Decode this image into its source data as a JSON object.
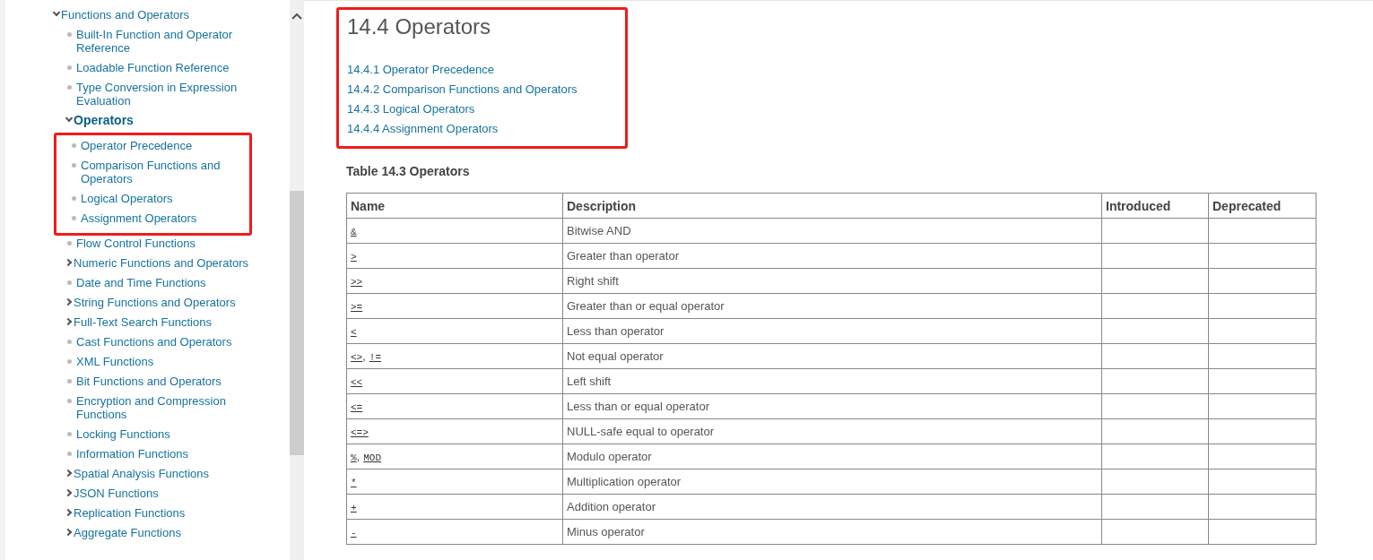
{
  "sidebar": {
    "items": [
      {
        "label": "Functions and Operators",
        "kind": "branch",
        "expanded": true,
        "selected": false,
        "children": [
          {
            "label": "Built-In Function and Operator Reference",
            "kind": "leaf",
            "selected": false
          },
          {
            "label": "Loadable Function Reference",
            "kind": "leaf",
            "selected": false
          },
          {
            "label": "Type Conversion in Expression Evaluation",
            "kind": "leaf",
            "selected": false
          },
          {
            "label": "Operators",
            "kind": "branch",
            "expanded": true,
            "selected": true,
            "highlighted": true,
            "children": [
              {
                "label": "Operator Precedence",
                "kind": "leaf",
                "selected": false
              },
              {
                "label": "Comparison Functions and Operators",
                "kind": "leaf",
                "selected": false
              },
              {
                "label": "Logical Operators",
                "kind": "leaf",
                "selected": false
              },
              {
                "label": "Assignment Operators",
                "kind": "leaf",
                "selected": false
              }
            ]
          },
          {
            "label": "Flow Control Functions",
            "kind": "leaf",
            "selected": false
          },
          {
            "label": "Numeric Functions and Operators",
            "kind": "branch",
            "expanded": false,
            "selected": false
          },
          {
            "label": "Date and Time Functions",
            "kind": "leaf",
            "selected": false
          },
          {
            "label": "String Functions and Operators",
            "kind": "branch",
            "expanded": false,
            "selected": false
          },
          {
            "label": "Full-Text Search Functions",
            "kind": "branch",
            "expanded": false,
            "selected": false
          },
          {
            "label": "Cast Functions and Operators",
            "kind": "leaf",
            "selected": false
          },
          {
            "label": "XML Functions",
            "kind": "leaf",
            "selected": false
          },
          {
            "label": "Bit Functions and Operators",
            "kind": "leaf",
            "selected": false
          },
          {
            "label": "Encryption and Compression Functions",
            "kind": "leaf",
            "selected": false
          },
          {
            "label": "Locking Functions",
            "kind": "leaf",
            "selected": false
          },
          {
            "label": "Information Functions",
            "kind": "leaf",
            "selected": false
          },
          {
            "label": "Spatial Analysis Functions",
            "kind": "branch",
            "expanded": false,
            "selected": false
          },
          {
            "label": "JSON Functions",
            "kind": "branch",
            "expanded": false,
            "selected": false
          },
          {
            "label": "Replication Functions",
            "kind": "branch",
            "expanded": false,
            "selected": false
          },
          {
            "label": "Aggregate Functions",
            "kind": "branch",
            "expanded": false,
            "selected": false
          }
        ]
      }
    ]
  },
  "content": {
    "title": "14.4 Operators",
    "highlighted": true,
    "toc": [
      "14.4.1 Operator Precedence",
      "14.4.2 Comparison Functions and Operators",
      "14.4.3 Logical Operators",
      "14.4.4 Assignment Operators"
    ],
    "table": {
      "caption": "Table 14.3 Operators",
      "columns": [
        "Name",
        "Description",
        "Introduced",
        "Deprecated"
      ],
      "rows": [
        {
          "names": [
            "&"
          ],
          "description": "Bitwise AND"
        },
        {
          "names": [
            ">"
          ],
          "description": "Greater than operator"
        },
        {
          "names": [
            ">>"
          ],
          "description": "Right shift"
        },
        {
          "names": [
            ">="
          ],
          "description": "Greater than or equal operator"
        },
        {
          "names": [
            "<"
          ],
          "description": "Less than operator"
        },
        {
          "names": [
            "<>",
            "!="
          ],
          "separator": ",",
          "description": "Not equal operator"
        },
        {
          "names": [
            "<<"
          ],
          "description": "Left shift"
        },
        {
          "names": [
            "<="
          ],
          "description": "Less than or equal operator"
        },
        {
          "names": [
            "<=>"
          ],
          "description": "NULL-safe equal to operator"
        },
        {
          "names": [
            "%",
            "MOD"
          ],
          "separator": ",",
          "description": "Modulo operator"
        },
        {
          "names": [
            "*"
          ],
          "description": "Multiplication operator"
        },
        {
          "names": [
            "+"
          ],
          "description": "Addition operator"
        },
        {
          "names": [
            "-"
          ],
          "description": "Minus operator"
        }
      ]
    }
  }
}
